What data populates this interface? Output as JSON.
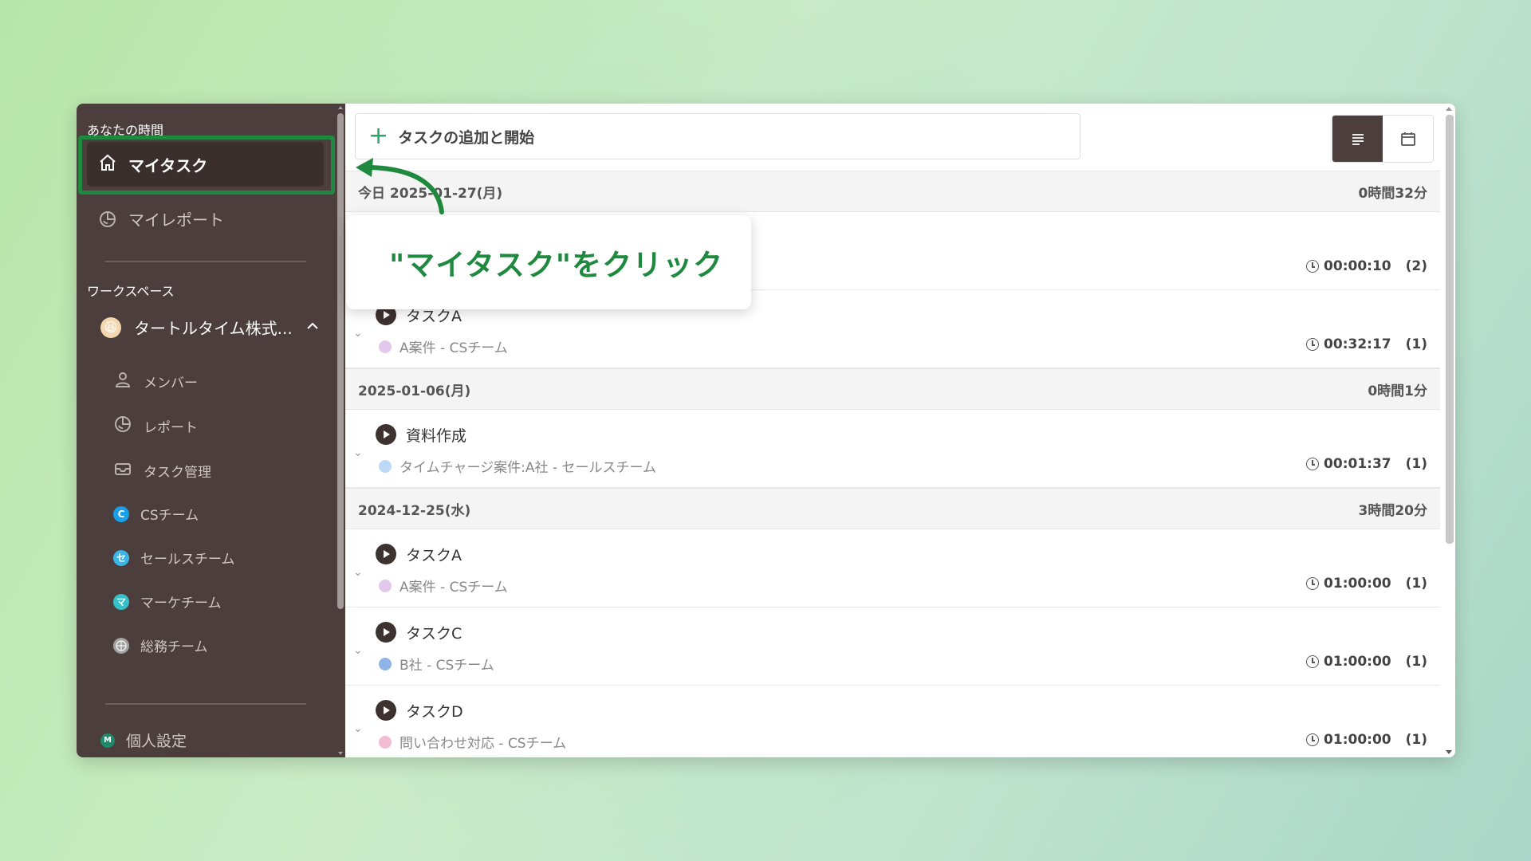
{
  "sidebar": {
    "section_your_time": "あなたの時間",
    "my_tasks": "マイタスク",
    "my_report": "マイレポート",
    "section_workspace": "ワークスペース",
    "workspace_name": "タートルタイム株式...",
    "workspace_avatar": "😆",
    "items": [
      {
        "label": "メンバー",
        "icon": "person-icon"
      },
      {
        "label": "レポート",
        "icon": "report-icon"
      },
      {
        "label": "タスク管理",
        "icon": "inbox-icon"
      },
      {
        "label": "CSチーム",
        "icon": "team-c-icon",
        "glyph": "C",
        "color": "#1aa0e6"
      },
      {
        "label": "セールスチーム",
        "icon": "team-se-icon",
        "glyph": "セ",
        "color": "#3ab6e6"
      },
      {
        "label": "マーケチーム",
        "icon": "team-ma-icon",
        "glyph": "マ",
        "color": "#35c1c9"
      },
      {
        "label": "総務チーム",
        "icon": "team-general-icon",
        "glyph": "",
        "color": "#a3a3a3"
      }
    ],
    "personal_settings": "個人設定",
    "personal_avatar": "M",
    "personal_avatar_color": "#1f8a6a"
  },
  "topbar": {
    "add_label": "タスクの追加と開始"
  },
  "callout": {
    "text": "\"マイタスク\"をクリック"
  },
  "groups": [
    {
      "date": "今日 2025-01-27(月)",
      "duration": "0時間32分",
      "tasks": [
        {
          "name": "",
          "project": "",
          "color": "",
          "time": "00:00:10",
          "count": "(2)"
        },
        {
          "name": "タスクA",
          "project": "A案件 - CSチーム",
          "color": "#e2c8ea",
          "time": "00:32:17",
          "count": "(1)"
        }
      ]
    },
    {
      "date": "2025-01-06(月)",
      "duration": "0時間1分",
      "tasks": [
        {
          "name": "資料作成",
          "project": "タイムチャージ案件:A社 - セールスチーム",
          "color": "#bcd8f4",
          "time": "00:01:37",
          "count": "(1)"
        }
      ]
    },
    {
      "date": "2024-12-25(水)",
      "duration": "3時間20分",
      "tasks": [
        {
          "name": "タスクA",
          "project": "A案件 - CSチーム",
          "color": "#e2c8ea",
          "time": "01:00:00",
          "count": "(1)"
        },
        {
          "name": "タスクC",
          "project": "B社 - CSチーム",
          "color": "#8fb4e8",
          "time": "01:00:00",
          "count": "(1)"
        },
        {
          "name": "タスクD",
          "project": "問い合わせ対応 - CSチーム",
          "color": "#f4bcd4",
          "time": "01:00:00",
          "count": "(1)"
        }
      ]
    }
  ]
}
